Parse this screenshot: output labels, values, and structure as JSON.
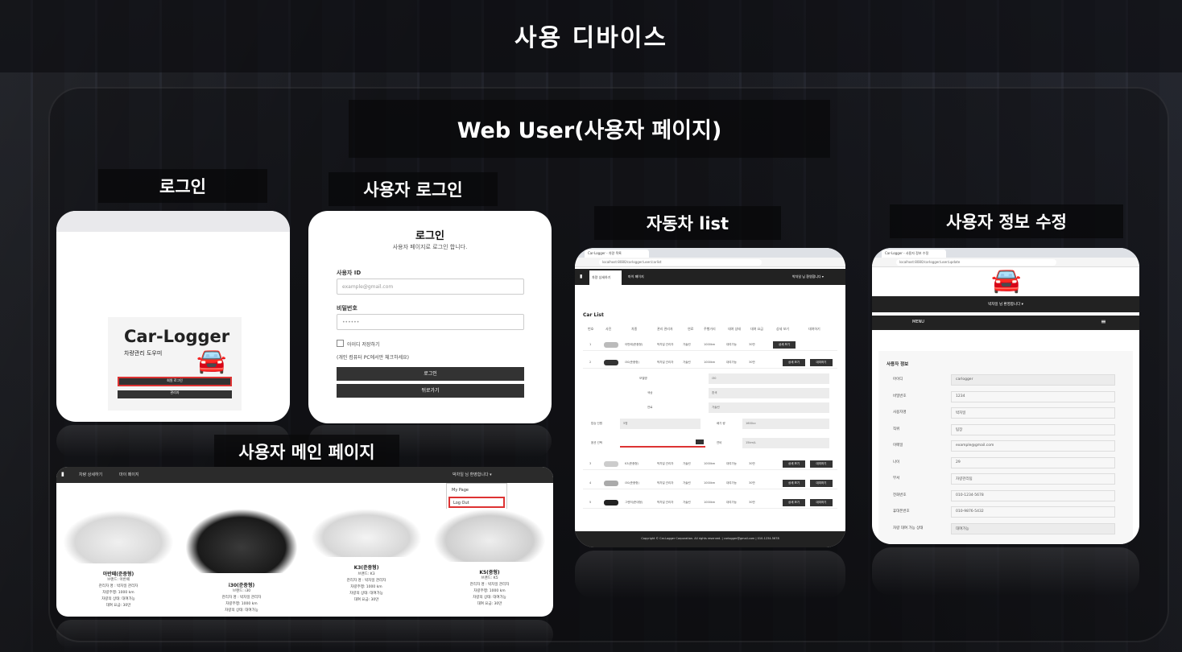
{
  "page": {
    "main_title": "사용 디바이스",
    "sub_title": "Web User(사용자 페이지)"
  },
  "sections": {
    "login": "로그인",
    "user_login": "사용자 로그인",
    "car_list": "자동차 list",
    "user_edit": "사용자 정보 수정",
    "user_main": "사용자 메인 페이지"
  },
  "login_screen": {
    "brand": "Car-Logger",
    "brand_sub": "차량관리 도우미",
    "btn_user": "회원 로그인",
    "btn_admin": "관리자"
  },
  "user_login_screen": {
    "title": "로그인",
    "desc": "사용자 페이지로 로그인 합니다.",
    "id_label": "사용자 ID",
    "id_placeholder": "example@gmail.com",
    "pw_label": "비밀번호",
    "pw_placeholder": "••••••",
    "remember": "아이디 저장하기",
    "remember_note": "(개인 컴퓨터 PC에서만 체크하세요)",
    "login_button": "로그인",
    "back_button": "뒤로가기"
  },
  "user_main_screen": {
    "menu_items": [
      "차량 상세하기",
      "마이 페이지"
    ],
    "user_greeting": "박차일 님 환영합니다 ▾",
    "dropdown": [
      "My Page",
      "Log Out"
    ],
    "cars": [
      {
        "name": "아반떼(준중형)",
        "info": [
          "브랜드: 아반떼",
          "관리자 명 : 박차일 관리자",
          "차량주행: 1000 km",
          "차량의 상태: 대여가능",
          "대여 요금: 30만"
        ]
      },
      {
        "name": "i30(준중형)",
        "info": [
          "브랜드: i30",
          "관리자 명 : 박차일 관리자",
          "차량주행: 1000 km",
          "차량의 상태: 대여가능"
        ]
      },
      {
        "name": "K3(준중형)",
        "info": [
          "브랜드: K3",
          "관리자 명 : 박차일 관리자",
          "차량주행: 1000 km",
          "차량의 상태: 대여가능",
          "대여 요금: 30만"
        ]
      },
      {
        "name": "K5(중형)",
        "info": [
          "브랜드: K5",
          "관리자 명 : 박차일 관리자",
          "차량주행: 1000 km",
          "차량의 상태: 대여가능",
          "대여 요금: 30만"
        ]
      }
    ]
  },
  "car_list_screen": {
    "tab_title": "Car-Logger - 차량 목록",
    "url": "localhost:8080/carlogger/user/carlist",
    "nav": [
      "차량 상세하기",
      "마이 페이지"
    ],
    "greeting": "박차일 님 환영합니다 ▾",
    "heading": "Car List",
    "columns": [
      "번호",
      "사진",
      "차종",
      "관리 관리자",
      "연료",
      "주행거리",
      "대여 상태",
      "대여 요금",
      "상세 보기",
      "대여하기"
    ],
    "rows": [
      {
        "no": "1",
        "model": "아반떼(준중형)",
        "admin": "박차일 관리자",
        "fuel": "가솔린",
        "km": "1000km",
        "state": "대여가능",
        "fee": "30만",
        "btns": [
          "상세 보기"
        ]
      },
      {
        "no": "2",
        "model": "i30(준중형)",
        "admin": "박차일 관리자",
        "fuel": "가솔린",
        "km": "1000km",
        "state": "대여가능",
        "fee": "30만",
        "btns": [
          "상세 보기",
          "대여하기"
        ]
      },
      {
        "no": "3",
        "model": "K3(준중형)",
        "admin": "박차일 관리자",
        "fuel": "가솔린",
        "km": "1000km",
        "state": "대여가능",
        "fee": "30만",
        "btns": [
          "상세 보기",
          "대여하기"
        ]
      },
      {
        "no": "4",
        "model": "i30(준중형)",
        "admin": "박차일 관리자",
        "fuel": "가솔린",
        "km": "1000km",
        "state": "대여가능",
        "fee": "30만",
        "btns": [
          "상세 보기",
          "대여하기"
        ]
      },
      {
        "no": "5",
        "model": "그랜저(준대형)",
        "admin": "박차일 관리자",
        "fuel": "가솔린",
        "km": "1000km",
        "state": "대여가능",
        "fee": "30만",
        "btns": [
          "상세 보기",
          "대여하기"
        ]
      }
    ],
    "detail": [
      {
        "k": "모델명",
        "v": "i30"
      },
      {
        "k": "색상",
        "v": "흰색"
      },
      {
        "k": "연료",
        "v": "가솔린"
      }
    ],
    "detail_pairs": [
      {
        "k": "탑승 인원",
        "v": "5명",
        "k2": "배기 량",
        "v2": "1600cc"
      },
      {
        "k": "옵션 선택",
        "v": "",
        "k2": "연비",
        "v2": "15km/L"
      }
    ],
    "footer": "Copyright © Car-Logger Corporation. All rights reserved. | carlogger@gmail.com | 010-1234-5678"
  },
  "user_edit_screen": {
    "tab_title": "Car-Logger - 사용자 정보 수정",
    "url": "localhost:8080/carlogger/user/update",
    "greeting": "박차일 님 환영합니다 ▾",
    "menu": "MENU",
    "heading": "사용자 정보",
    "fields": [
      {
        "k": "아이디",
        "v": "carlogger",
        "grey": true
      },
      {
        "k": "비밀번호",
        "v": "1234",
        "grey": false
      },
      {
        "k": "사용자명",
        "v": "박차일",
        "grey": false
      },
      {
        "k": "직위",
        "v": "팀장",
        "grey": false
      },
      {
        "k": "이메일",
        "v": "example@gmail.com",
        "grey": false
      },
      {
        "k": "나이",
        "v": "29",
        "grey": false
      },
      {
        "k": "부서",
        "v": "차량관리팀",
        "grey": false
      },
      {
        "k": "전화번호",
        "v": "010-1234-5678",
        "grey": false
      },
      {
        "k": "휴대폰번호",
        "v": "010-9876-5432",
        "grey": false
      },
      {
        "k": "차량 대여 가능 상태",
        "v": "대여가능",
        "grey": true
      }
    ]
  },
  "colors": {
    "background": "#141416",
    "accent_red": "#dd3333",
    "dark_bar": "#2b2b2b"
  }
}
